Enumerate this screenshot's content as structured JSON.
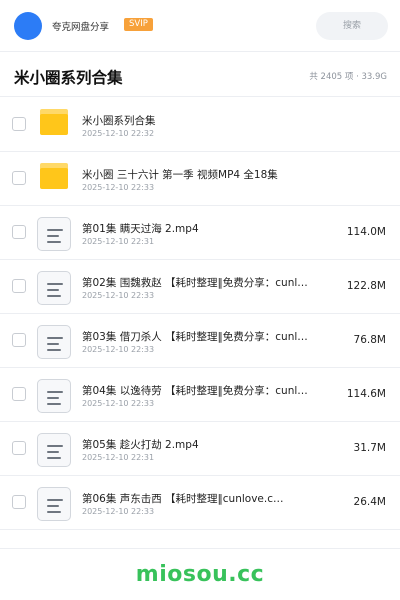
{
  "header": {
    "user_name": "夸克网盘分享",
    "badge": "SVIP",
    "search_placeholder": "搜索"
  },
  "title_bar": {
    "title": "米小圈系列合集",
    "stats": "共 2405 项 · 33.9G"
  },
  "files": [
    {
      "type": "folder",
      "name": "米小圈系列合集",
      "date": "2025-12-10 22:32",
      "size": ""
    },
    {
      "type": "folder",
      "name": "米小圈 三十六计 第一季 视频MP4 全18集",
      "date": "2025-12-10 22:33",
      "size": ""
    },
    {
      "type": "file",
      "name": "第01集 瞒天过海 2.mp4",
      "date": "2025-12-10 22:31",
      "size": "114.0M"
    },
    {
      "type": "file",
      "name": "第02集 围魏救赵 【耗时整理‖免费分享：cunl…",
      "date": "2025-12-10 22:33",
      "size": "122.8M"
    },
    {
      "type": "file",
      "name": "第03集 借刀杀人 【耗时整理‖免费分享：cunl…",
      "date": "2025-12-10 22:33",
      "size": "76.8M"
    },
    {
      "type": "file",
      "name": "第04集 以逸待劳 【耗时整理‖免费分享：cunl…",
      "date": "2025-12-10 22:33",
      "size": "114.6M"
    },
    {
      "type": "file",
      "name": "第05集 趁火打劫 2.mp4",
      "date": "2025-12-10 22:31",
      "size": "31.7M"
    },
    {
      "type": "file",
      "name": "第06集 声东击西 【耗时整理‖cunlove.c…",
      "date": "2025-12-10 22:33",
      "size": "26.4M"
    }
  ],
  "watermark": "miosou.cc",
  "colors": {
    "avatar": "#2c7cf6",
    "badge": "#f7a13a",
    "folder": "#ffc61a",
    "watermark": "#38c25b"
  }
}
